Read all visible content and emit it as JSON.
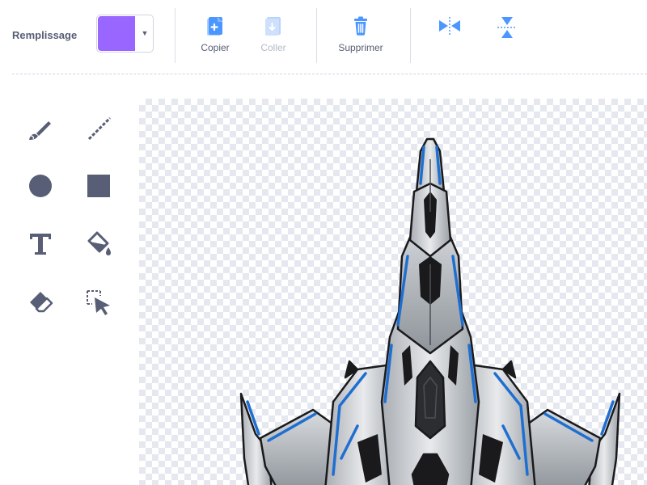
{
  "toolbar": {
    "fill_label": "Remplissage",
    "fill_color": "#9966ff",
    "copy_label": "Copier",
    "paste_label": "Coller",
    "delete_label": "Supprimer"
  },
  "icons": {
    "copy": "copy-icon",
    "paste": "paste-icon",
    "delete": "trash-icon",
    "flip_horizontal": "flip-horizontal-icon",
    "flip_vertical": "flip-vertical-icon",
    "brush": "brush-icon",
    "line": "line-icon",
    "circle": "circle-icon",
    "rectangle": "rectangle-icon",
    "text": "text-icon",
    "fill": "fill-bucket-icon",
    "eraser": "eraser-icon",
    "select": "select-icon"
  },
  "colors": {
    "accent": "#4c97ff",
    "tool_gray": "#575e75",
    "disabled": "#b4bac6"
  }
}
